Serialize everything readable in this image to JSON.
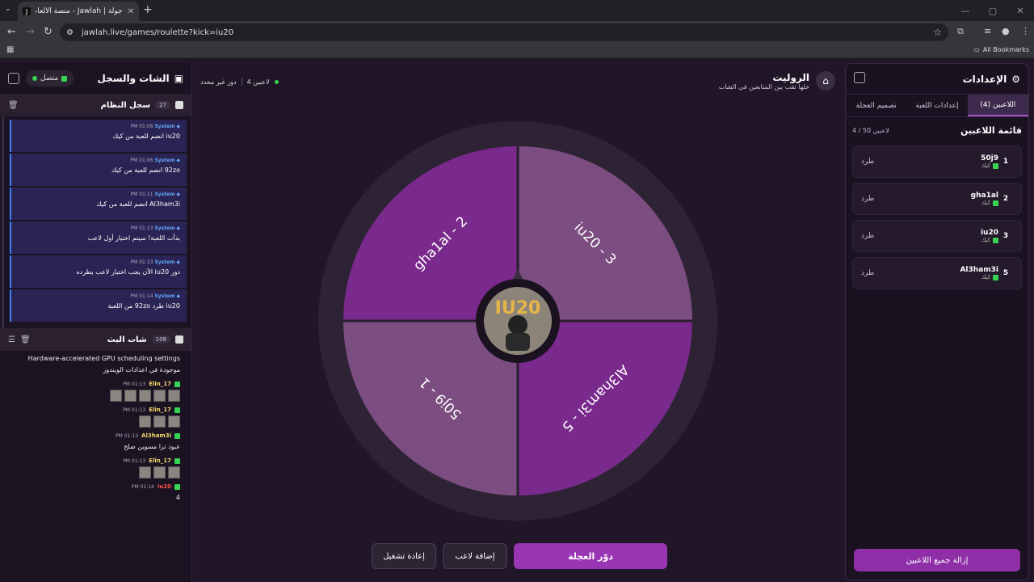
{
  "browser": {
    "tab_title": "جولة | Jawlah - منصة الألعاب الت...",
    "url": "jawlah.live/games/roulette?kick=iu20",
    "bookmarks_label": "All Bookmarks"
  },
  "settings": {
    "title": "الإعدادات",
    "tabs": [
      "اللاعبين (4)",
      "إعدادات اللعبة",
      "تصميم العجلة"
    ],
    "list_title": "قائمة اللاعبين",
    "count": "4 / 50 لاعبين",
    "players": [
      {
        "idx": "1",
        "name": "50j9",
        "source": "كيك",
        "kick": "طرد"
      },
      {
        "idx": "2",
        "name": "gha1al",
        "source": "كيك",
        "kick": "طرد"
      },
      {
        "idx": "3",
        "name": "iu20",
        "source": "كيك",
        "kick": "طرد"
      },
      {
        "idx": "5",
        "name": "Al3ham3i",
        "source": "كيك",
        "kick": "طرد"
      }
    ],
    "remove_all": "إزالة جميع اللاعبين"
  },
  "chat": {
    "title": "الشات والسجل",
    "status": "متصل",
    "system_log_title": "سجل النظام",
    "system_log_count": "27",
    "system_messages": [
      {
        "time": "PM 01:06",
        "sender": "System",
        "text": "iu20 انضم للعبة من كيك"
      },
      {
        "time": "PM 01:06",
        "sender": "System",
        "text": "92zo انضم للعبة من كيك"
      },
      {
        "time": "PM 01:11",
        "sender": "System",
        "text": "Al3ham3i انضم للعبة من كيك"
      },
      {
        "time": "PM 01:13",
        "sender": "System",
        "text": "بدأت اللعبة! سيتم اختيار أول لاعب"
      },
      {
        "time": "PM 01:13",
        "sender": "System",
        "text": "دور iu20 الآن يجب اختيار لاعب يطرده"
      },
      {
        "time": "PM 01:14",
        "sender": "System",
        "text": "iu20 طرد 92zo من اللعبة"
      }
    ],
    "live_title": "شات البث",
    "live_count": "108",
    "live_messages": [
      {
        "user": "",
        "time": "",
        "color": "#39d353",
        "text": "Hardware-accelerated GPU scheduling settings موجودة في اعدادات الويندوز",
        "emotes": 0
      },
      {
        "user": "Elin_17",
        "time": "PM 01:13",
        "color": "#f5d76e",
        "text": "",
        "emotes": 5
      },
      {
        "user": "Elin_17",
        "time": "PM 01:13",
        "color": "#f5d76e",
        "text": "",
        "emotes": 3
      },
      {
        "user": "Al3ham3i",
        "time": "PM 01:13",
        "color": "#f5d76e",
        "text": "عبود ترا مسوين صلح",
        "emotes": 0
      },
      {
        "user": "Elin_17",
        "time": "PM 01:13",
        "color": "#f5d76e",
        "text": "",
        "emotes": 3
      },
      {
        "user": "iu20",
        "time": "PM 01:14",
        "color": "#ff4d4d",
        "text": "4",
        "emotes": 0
      }
    ]
  },
  "game": {
    "title": "الروليت",
    "subtitle": "خلها تقب بين المتابعين في الشات",
    "players_status": "4 لاعبين",
    "turn_status": "دور غير محدد",
    "segments": [
      {
        "label": "iu20 - 3",
        "color": "#7b4d80"
      },
      {
        "label": "Al3ham3i - 5",
        "color": "#7a2a8c"
      },
      {
        "label": "50j9 - 1",
        "color": "#7b4d80"
      },
      {
        "label": "gha1al - 2",
        "color": "#7a2a8c"
      }
    ],
    "center_text": "IU20",
    "buttons": {
      "spin": "دوّر العجلة",
      "add": "إضافة لاعب",
      "reset": "إعادة تشغيل"
    }
  }
}
